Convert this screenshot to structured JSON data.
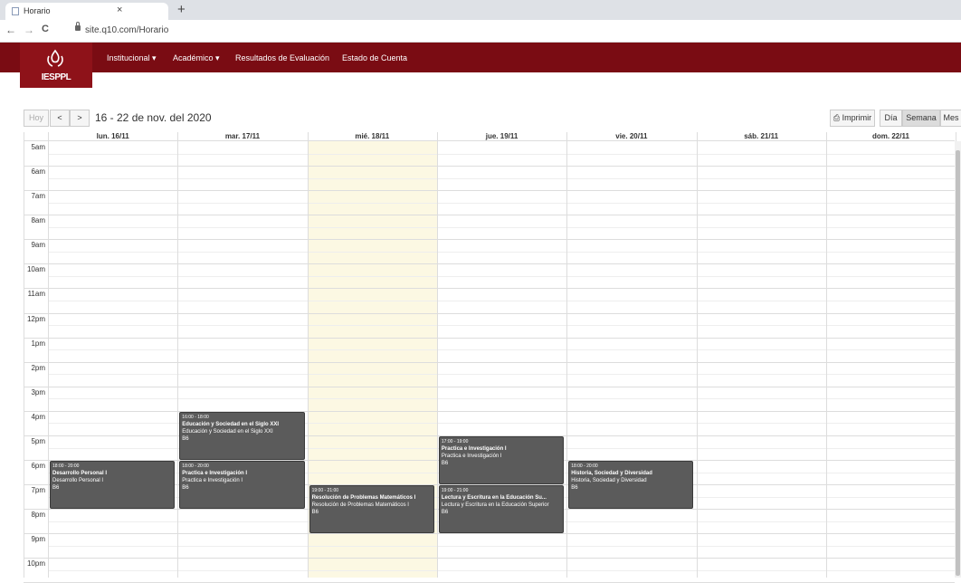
{
  "browser": {
    "tab_title": "Horario",
    "tab_close": "×",
    "new_tab": "+",
    "back": "←",
    "forward": "→",
    "reload": "C",
    "url": "site.q10.com/Horario"
  },
  "site": {
    "logo_text": "IESPPL",
    "brand_color": "#7a0c13",
    "menu": [
      {
        "label": "Institucional ▾"
      },
      {
        "label": "Académico ▾"
      },
      {
        "label": "Resultados de Evaluación"
      },
      {
        "label": "Estado de Cuenta"
      }
    ]
  },
  "toolbar": {
    "today": "Hoy",
    "prev": "<",
    "next": ">",
    "range_title": "16 - 22 de nov. del 2020",
    "print": "Imprimir",
    "views": [
      "Día",
      "Semana",
      "Mes"
    ],
    "active_view": "Semana"
  },
  "calendar": {
    "days": [
      "lun. 16/11",
      "mar. 17/11",
      "mié. 18/11",
      "jue. 19/11",
      "vie. 20/11",
      "sáb. 21/11",
      "dom. 22/11"
    ],
    "today_index": 2,
    "hours": [
      "5am",
      "6am",
      "7am",
      "8am",
      "9am",
      "10am",
      "11am",
      "12pm",
      "1pm",
      "2pm",
      "3pm",
      "4pm",
      "5pm",
      "6pm",
      "7pm",
      "8pm",
      "9pm",
      "10pm"
    ],
    "events": [
      {
        "day": 0,
        "start": 18,
        "end": 20,
        "time": "18:00 - 20:00",
        "title": "Desarrollo Personal I",
        "subtitle": "Desarrollo Personal I",
        "room": "B6"
      },
      {
        "day": 1,
        "start": 16,
        "end": 18,
        "time": "16:00 - 18:00",
        "title": "Educación y Sociedad en el Siglo XXI",
        "subtitle": "Educación y Sociedad en el Siglo XXI",
        "room": "B6"
      },
      {
        "day": 1,
        "start": 18,
        "end": 20,
        "time": "18:00 - 20:00",
        "title": "Practica e Investigación I",
        "subtitle": "Practica e Investigación I",
        "room": "B6"
      },
      {
        "day": 2,
        "start": 19,
        "end": 21,
        "time": "19:00 - 21:00",
        "title": "Resolución de Problemas Matemáticos I",
        "subtitle": "Resolución de Problemas Matemáticos I",
        "room": "B6"
      },
      {
        "day": 3,
        "start": 17,
        "end": 19,
        "time": "17:00 - 19:00",
        "title": "Practica e Investigación I",
        "subtitle": "Practica e Investigación I",
        "room": "B6"
      },
      {
        "day": 3,
        "start": 19,
        "end": 21,
        "time": "19:00 - 21:00",
        "title": "Lectura y Escritura en la Educación Su...",
        "subtitle": "Lectura y Escritura en la Educación Superior",
        "room": "B6"
      },
      {
        "day": 4,
        "start": 18,
        "end": 20,
        "time": "18:00 - 20:00",
        "title": "Historia, Sociedad y Diversidad",
        "subtitle": "Historia, Sociedad y Diversidad",
        "room": "B6"
      }
    ]
  }
}
